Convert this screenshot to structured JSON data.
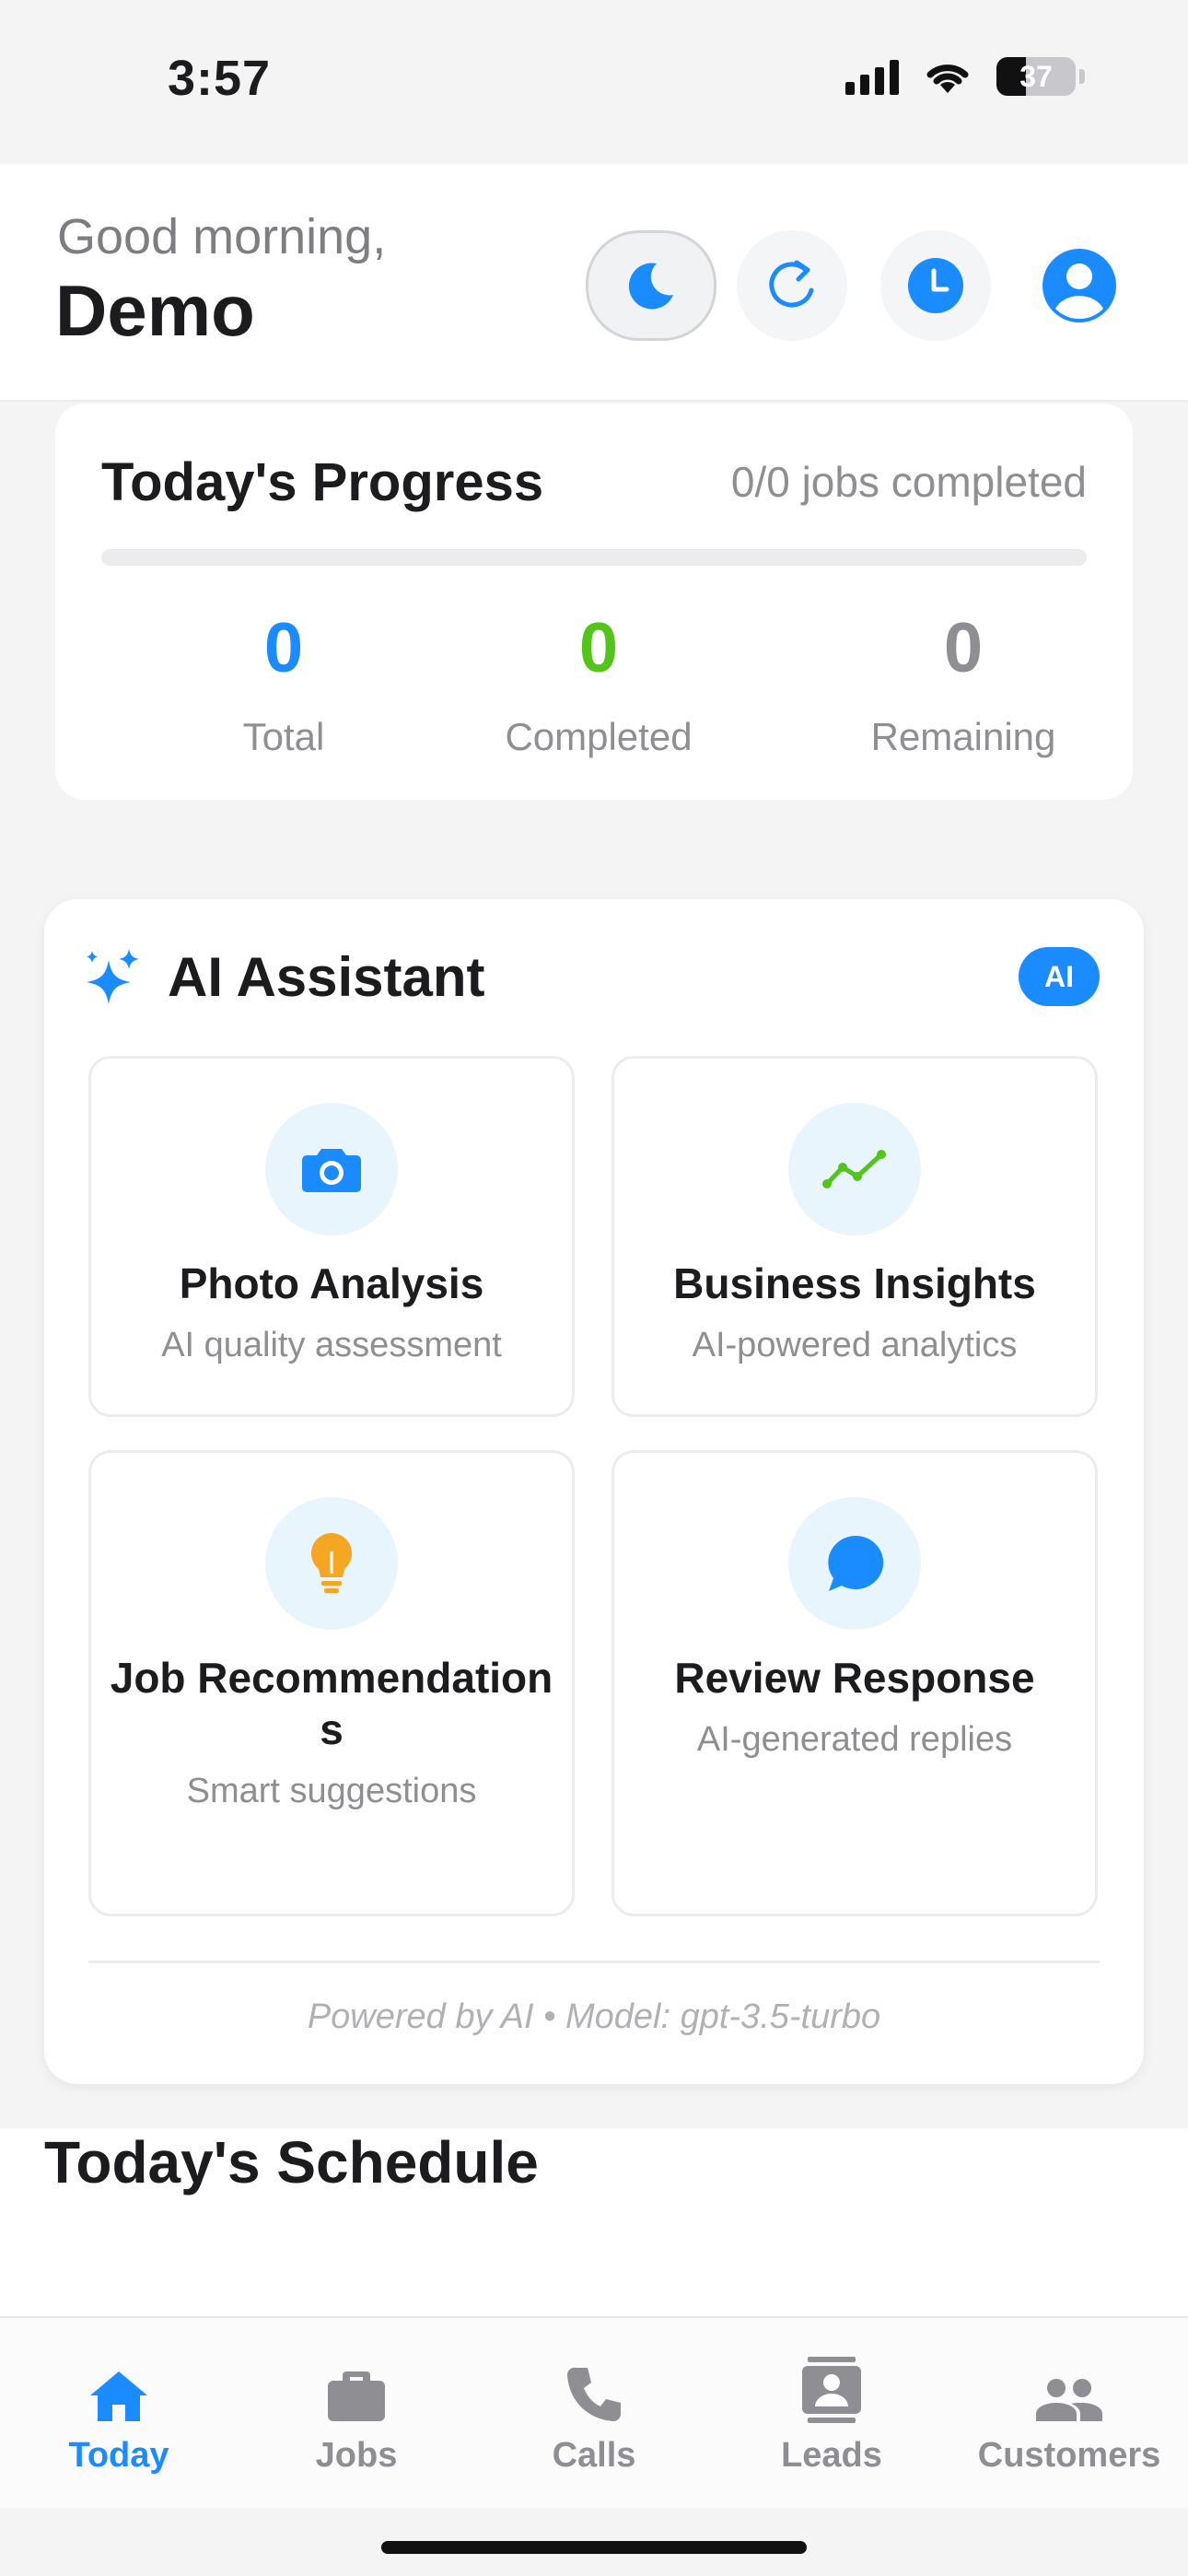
{
  "status_bar": {
    "time": "3:57",
    "battery": "37",
    "battery_level_percent": 37
  },
  "header": {
    "greeting": "Good morning,",
    "user_name": "Demo",
    "buttons": [
      "moon-icon",
      "refresh-icon",
      "clock-icon",
      "profile-icon"
    ]
  },
  "progress": {
    "title": "Today's Progress",
    "summary": "0/0 jobs completed",
    "fill_percent": 0,
    "stats": {
      "total": {
        "value": "0",
        "label": "Total",
        "color": "#1a8cff"
      },
      "completed": {
        "value": "0",
        "label": "Completed",
        "color": "#52c41a"
      },
      "remaining": {
        "value": "0",
        "label": "Remaining",
        "color": "#8e8e93"
      }
    }
  },
  "ai_assistant": {
    "title": "AI Assistant",
    "badge": "AI",
    "tiles": [
      {
        "title": "Photo Analysis",
        "subtitle": "AI quality assessment",
        "icon": "camera-icon"
      },
      {
        "title": "Business Insights",
        "subtitle": "AI-powered analytics",
        "icon": "trend-line-icon"
      },
      {
        "title": "Job Recommendations",
        "subtitle": "Smart suggestions",
        "icon": "lightbulb-icon"
      },
      {
        "title": "Review Response",
        "subtitle": "AI-generated replies",
        "icon": "chat-bubble-icon"
      }
    ],
    "footer": "Powered by AI • Model: gpt-3.5-turbo"
  },
  "schedule": {
    "title": "Today's Schedule"
  },
  "tabs": [
    {
      "label": "Today",
      "icon": "home-icon",
      "active": true
    },
    {
      "label": "Jobs",
      "icon": "briefcase-icon",
      "active": false
    },
    {
      "label": "Calls",
      "icon": "phone-icon",
      "active": false
    },
    {
      "label": "Leads",
      "icon": "contact-card-icon",
      "active": false
    },
    {
      "label": "Customers",
      "icon": "people-icon",
      "active": false
    }
  ],
  "colors": {
    "accent": "#1a8cff",
    "success": "#52c41a",
    "muted": "#8e8e93",
    "warning": "#f5a623"
  }
}
